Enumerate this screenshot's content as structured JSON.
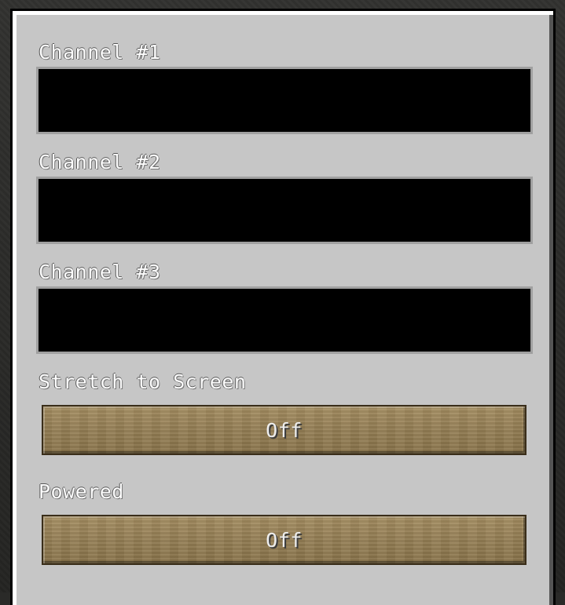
{
  "channels": [
    {
      "label": "Channel #1",
      "value": ""
    },
    {
      "label": "Channel #2",
      "value": ""
    },
    {
      "label": "Channel #3",
      "value": ""
    }
  ],
  "stretch": {
    "label": "Stretch to Screen",
    "state": "Off"
  },
  "powered": {
    "label": "Powered",
    "state": "Off"
  },
  "colors": {
    "panel": "#c6c6c6",
    "field": "#000000",
    "button_wood": "#957f55",
    "label_text": "#fdfdfd"
  }
}
